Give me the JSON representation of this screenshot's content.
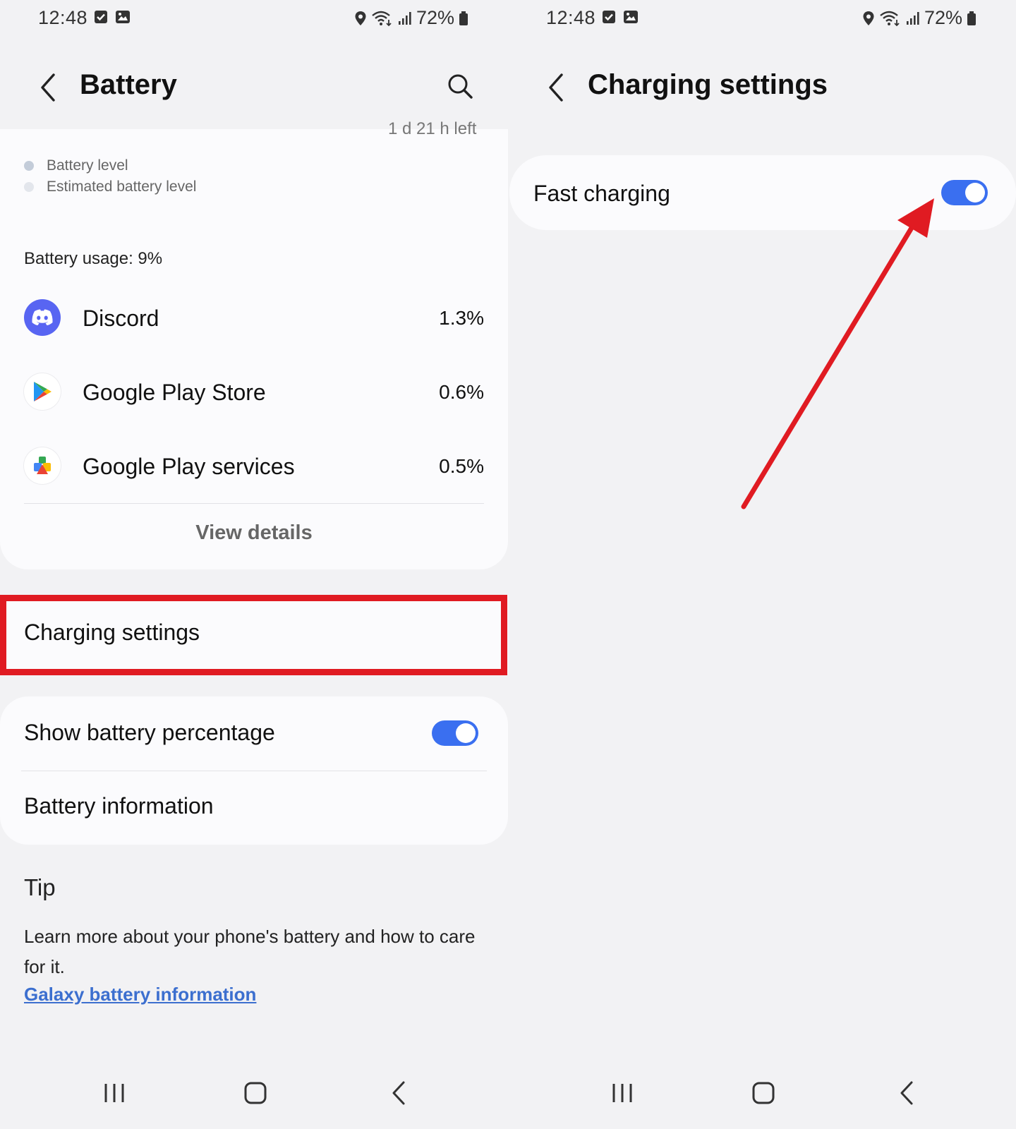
{
  "status_bar": {
    "time": "12:48",
    "battery_percent": "72%"
  },
  "left": {
    "title": "Battery",
    "cut_text": "1 d 21 h left",
    "legend": [
      {
        "label": "Battery level",
        "color": "#c3ccd9"
      },
      {
        "label": "Estimated battery level",
        "color": "#e3e6ec"
      }
    ],
    "usage_label": "Battery usage: 9%",
    "apps": [
      {
        "name": "Discord",
        "percent": "1.3%"
      },
      {
        "name": "Google Play Store",
        "percent": "0.6%"
      },
      {
        "name": "Google Play services",
        "percent": "0.5%"
      }
    ],
    "view_details": "View details",
    "charging_settings": "Charging settings",
    "show_battery_percentage": {
      "label": "Show battery percentage",
      "on": true
    },
    "battery_information": "Battery information",
    "tip": {
      "title": "Tip",
      "body": "Learn more about your phone's battery and how to care for it.",
      "link": "Galaxy battery information"
    }
  },
  "right": {
    "title": "Charging settings",
    "fast_charging": {
      "label": "Fast charging",
      "on": true
    }
  },
  "colors": {
    "toggle_on": "#3a6ff0",
    "highlight": "#e01b22",
    "link": "#3c6fcf"
  }
}
